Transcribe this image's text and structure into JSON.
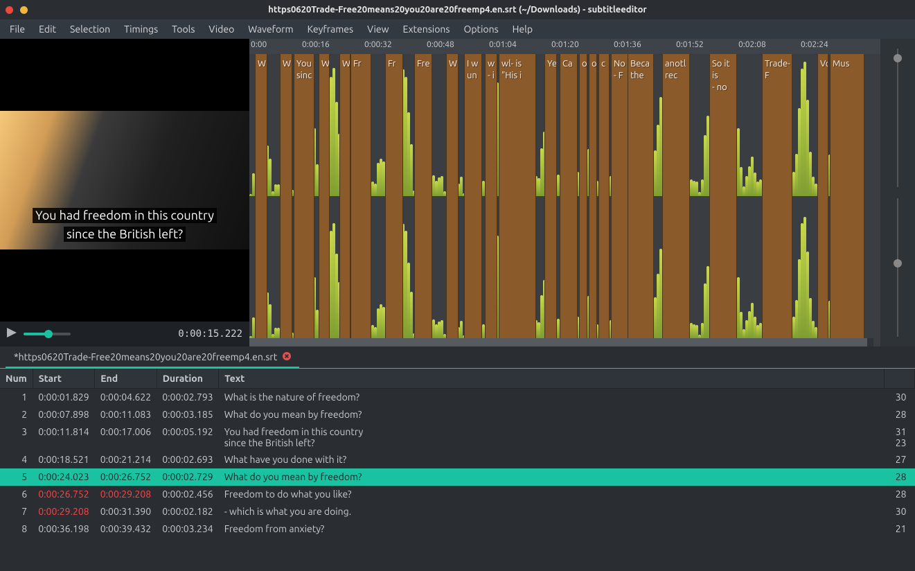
{
  "window_title": "https0620Trade-Free20means20you20are20freemp4.en.srt (~/Downloads) - subtitleeditor",
  "menu": [
    "File",
    "Edit",
    "Selection",
    "Timings",
    "Tools",
    "Video",
    "Waveform",
    "Keyframes",
    "View",
    "Extensions",
    "Options",
    "Help"
  ],
  "subtitle_overlay_l1": "You had freedom in this country",
  "subtitle_overlay_l2": "since the British left?",
  "player_time": "0:00:15.222",
  "ruler_ticks": [
    "0:00",
    "0:00:16",
    "0:00:32",
    "0:00:48",
    "0:01:04",
    "0:01:20",
    "0:01:36",
    "0:01:52",
    "0:02:08",
    "0:02:24"
  ],
  "tab_name": "*https0620Trade-Free20means20you20are20freemp4.en.srt",
  "col": {
    "num": "Num",
    "start": "Start",
    "end": "End",
    "dur": "Duration",
    "text": "Text"
  },
  "rows": [
    {
      "num": "1",
      "start": "0:00:01.829",
      "end": "0:00:04.622",
      "dur": "0:00:02.793",
      "text": "What is the nature of freedom?",
      "c1": "30"
    },
    {
      "num": "2",
      "start": "0:00:07.898",
      "end": "0:00:11.083",
      "dur": "0:00:03.185",
      "text": "What do you mean by freedom?",
      "c1": "28"
    },
    {
      "num": "3",
      "start": "0:00:11.814",
      "end": "0:00:17.006",
      "dur": "0:00:05.192",
      "text": "You had freedom in this country\nsince the British left?",
      "c1": "31",
      "c2": "23"
    },
    {
      "num": "4",
      "start": "0:00:18.521",
      "end": "0:00:21.214",
      "dur": "0:00:02.693",
      "text": "What have you done with it?",
      "c1": "27"
    },
    {
      "num": "5",
      "start": "0:00:24.023",
      "end": "0:00:26.752",
      "dur": "0:00:02.729",
      "text": "What do you mean by freedom?",
      "c1": "28",
      "sel": true,
      "end_red": true
    },
    {
      "num": "6",
      "start": "0:00:26.752",
      "end": "0:00:29.208",
      "dur": "0:00:02.456",
      "text": "Freedom to do what you like?",
      "c1": "28",
      "start_red": true,
      "end_red": true
    },
    {
      "num": "7",
      "start": "0:00:29.208",
      "end": "0:00:31.390",
      "dur": "0:00:02.182",
      "text": "- which is what you are doing.",
      "c1": "30",
      "start_red": true
    },
    {
      "num": "8",
      "start": "0:00:36.198",
      "end": "0:00:39.432",
      "dur": "0:00:03.234",
      "text": "Freedom from anxiety?",
      "c1": "21"
    }
  ],
  "clips": [
    {
      "l": 8,
      "w": 18,
      "t": "W"
    },
    {
      "l": 44,
      "w": 18,
      "t": "W"
    },
    {
      "l": 64,
      "w": 30,
      "t": "You\nsinc"
    },
    {
      "l": 100,
      "w": 16,
      "t": "W"
    },
    {
      "l": 130,
      "w": 16,
      "t": "W"
    },
    {
      "l": 146,
      "w": 30,
      "t": "Fr"
    },
    {
      "l": 196,
      "w": 26,
      "t": "Fr"
    },
    {
      "l": 238,
      "w": 26,
      "t": "Fre"
    },
    {
      "l": 284,
      "w": 18,
      "t": "W"
    },
    {
      "l": 310,
      "w": 26,
      "t": "I w\nun"
    },
    {
      "l": 340,
      "w": 18,
      "t": "w\n- i"
    },
    {
      "l": 360,
      "w": 54,
      "t": "wl- is\n\"His i"
    },
    {
      "l": 426,
      "w": 18,
      "t": "Ye"
    },
    {
      "l": 448,
      "w": 26,
      "t": "Ca"
    },
    {
      "l": 476,
      "w": 12,
      "t": "o"
    },
    {
      "l": 490,
      "w": 12,
      "t": "o"
    },
    {
      "l": 504,
      "w": 16,
      "t": "c"
    },
    {
      "l": 522,
      "w": 30,
      "t": "No\n- F"
    },
    {
      "l": 546,
      "w": 38,
      "t": "Beca\nthe"
    },
    {
      "l": 596,
      "w": 40,
      "t": "anotl\nrec"
    },
    {
      "l": 664,
      "w": 40,
      "t": "So it is\n- no"
    },
    {
      "l": 740,
      "w": 44,
      "t": "Trade-F"
    },
    {
      "l": 820,
      "w": 16,
      "t": "Voi"
    },
    {
      "l": 838,
      "w": 50,
      "t": "Mus"
    }
  ]
}
